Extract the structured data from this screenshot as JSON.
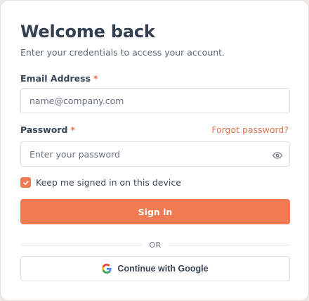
{
  "header": {
    "title": "Welcome back",
    "subtitle": "Enter your credentials to access your account."
  },
  "email": {
    "label": "Email Address",
    "required_mark": "*",
    "placeholder": "name@company.com",
    "value": ""
  },
  "password": {
    "label": "Password",
    "required_mark": "*",
    "placeholder": "Enter your password",
    "value": "",
    "forgot_label": "Forgot password?",
    "toggle_icon": "eye-icon"
  },
  "remember": {
    "label": "Keep me signed in on this device",
    "checked": true
  },
  "actions": {
    "signin_label": "Sign in",
    "divider_label": "OR",
    "google_label": "Continue with Google"
  },
  "colors": {
    "accent": "#f27a52",
    "title": "#34404f",
    "text": "#5d6672",
    "border": "#e2e0dc"
  }
}
